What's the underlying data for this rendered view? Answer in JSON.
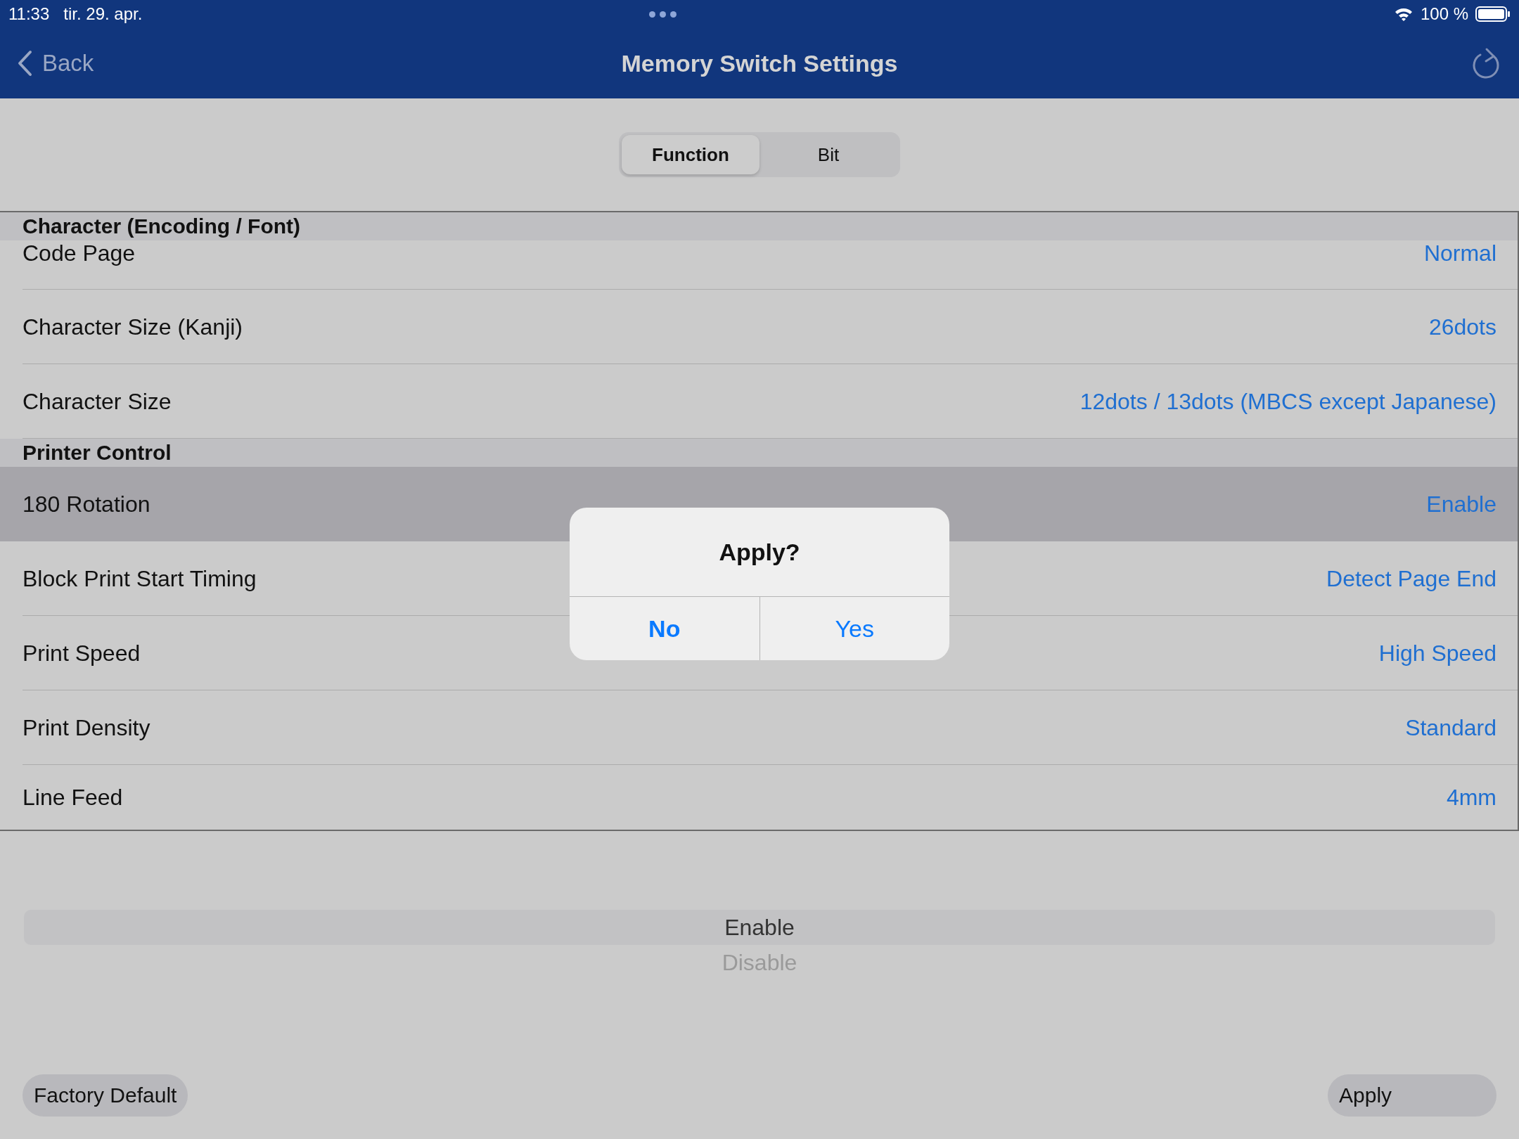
{
  "status_bar": {
    "time": "11:33",
    "date": "tir. 29. apr.",
    "battery": "100 %"
  },
  "nav_bar": {
    "back": "Back",
    "title": "Memory Switch Settings"
  },
  "segments": [
    {
      "label": "Function",
      "selected": true
    },
    {
      "label": "Bit",
      "selected": false
    }
  ],
  "sections": [
    {
      "title": "Character (Encoding / Font)",
      "rows": [
        {
          "label": "Code Page",
          "value": "Normal",
          "selected": false,
          "kind": "first"
        },
        {
          "label": "Character Size (Kanji)",
          "value": "26dots",
          "selected": false,
          "kind": "normal"
        },
        {
          "label": "Character Size",
          "value": "12dots / 13dots (MBCS except Japanese)",
          "selected": false,
          "kind": "normal"
        }
      ]
    },
    {
      "title": "Printer Control",
      "rows": [
        {
          "label": "180 Rotation",
          "value": "Enable",
          "selected": true,
          "kind": "normal"
        },
        {
          "label": "Block Print Start Timing",
          "value": "Detect Page End",
          "selected": false,
          "kind": "normal"
        },
        {
          "label": "Print Speed",
          "value": "High Speed",
          "selected": false,
          "kind": "normal"
        },
        {
          "label": "Print Density",
          "value": "Standard",
          "selected": false,
          "kind": "normal"
        },
        {
          "label": "Line Feed",
          "value": "4mm",
          "selected": false,
          "kind": "last"
        }
      ]
    }
  ],
  "picker": {
    "options": [
      {
        "label": "Enable",
        "selected": true
      },
      {
        "label": "Disable",
        "selected": false
      }
    ]
  },
  "footer_buttons": [
    {
      "label": "Factory Default",
      "kind": "left"
    },
    {
      "label": "Apply",
      "kind": "right"
    }
  ],
  "dialog": {
    "title": "Apply?",
    "buttons": [
      {
        "label": "No",
        "kind": "preferred"
      },
      {
        "label": "Yes",
        "kind": "normal"
      }
    ]
  }
}
